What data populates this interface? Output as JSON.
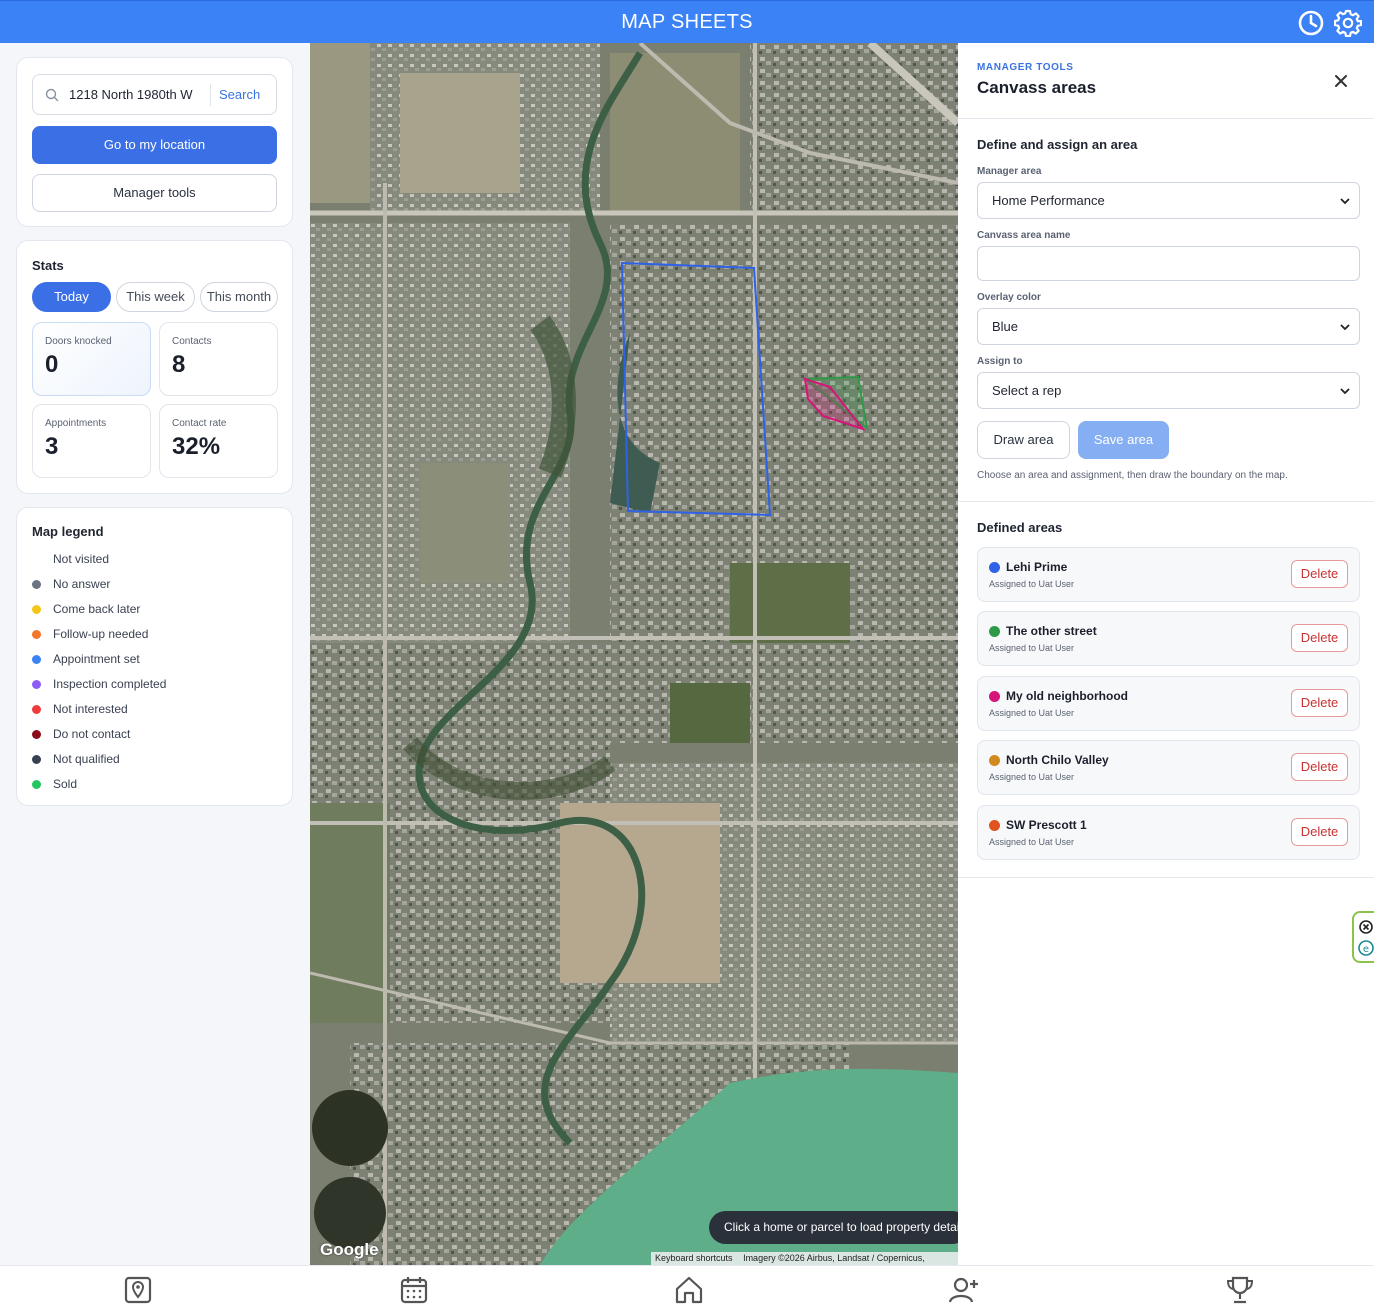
{
  "app": {
    "title": "MAP SHEETS"
  },
  "header_icons": [
    "clock-icon",
    "gear-icon"
  ],
  "search": {
    "value": "1218 North 1980th W",
    "button": "Search"
  },
  "buttons": {
    "go_location": "Go to my location",
    "manager_tools": "Manager tools"
  },
  "stats": {
    "title": "Stats",
    "tabs": [
      "Today",
      "This week",
      "This month"
    ],
    "active_tab": "Today",
    "items": [
      {
        "label": "Doors knocked",
        "value": "0"
      },
      {
        "label": "Contacts",
        "value": "8"
      },
      {
        "label": "Appointments",
        "value": "3"
      },
      {
        "label": "Contact rate",
        "value": "32%"
      }
    ]
  },
  "legend": {
    "title": "Map legend",
    "items": [
      {
        "label": "Not visited",
        "color": "#ffffff"
      },
      {
        "label": "No answer",
        "color": "#6b7280"
      },
      {
        "label": "Come back later",
        "color": "#f5c518"
      },
      {
        "label": "Follow-up needed",
        "color": "#f2772c"
      },
      {
        "label": "Appointment set",
        "color": "#3b82f6"
      },
      {
        "label": "Inspection completed",
        "color": "#8b5cf6"
      },
      {
        "label": "Not interested",
        "color": "#ef3b3b"
      },
      {
        "label": "Do not contact",
        "color": "#8b0d1a"
      },
      {
        "label": "Not qualified",
        "color": "#374151"
      },
      {
        "label": "Sold",
        "color": "#22c55e"
      }
    ]
  },
  "map": {
    "toast": "Click a home or parcel to load property details",
    "logo": "Google",
    "attribution": [
      "Keyboard shortcuts",
      "Imagery ©2026 Airbus, Landsat / Copernicus,"
    ]
  },
  "panel": {
    "kicker": "MANAGER TOOLS",
    "title": "Canvass areas",
    "section_title": "Define and assign an area",
    "fields": {
      "manager_area": {
        "label": "Manager area",
        "value": "Home Performance"
      },
      "canvass_name": {
        "label": "Canvass area name",
        "value": ""
      },
      "overlay_color": {
        "label": "Overlay color",
        "value": "Blue"
      },
      "assign_to": {
        "label": "Assign to",
        "value": "Select a rep"
      }
    },
    "draw_button": "Draw area",
    "save_button": "Save area",
    "hint": "Choose an area and assignment, then draw the boundary on the map.",
    "defined_title": "Defined areas",
    "delete_label": "Delete",
    "areas": [
      {
        "name": "Lehi Prime",
        "assigned": "Assigned to Uat User",
        "color": "#2f62e6"
      },
      {
        "name": "The other street",
        "assigned": "Assigned to Uat User",
        "color": "#2e9a48"
      },
      {
        "name": "My old neighborhood",
        "assigned": "Assigned to Uat User",
        "color": "#d6157a"
      },
      {
        "name": "North Chilo Valley",
        "assigned": "Assigned to Uat User",
        "color": "#d08a1e"
      },
      {
        "name": "SW Prescott 1",
        "assigned": "Assigned to Uat User",
        "color": "#e0541f"
      }
    ]
  },
  "bottom_nav": [
    "map-pin-icon",
    "calendar-icon",
    "home-icon",
    "add-user-icon",
    "trophy-icon"
  ]
}
